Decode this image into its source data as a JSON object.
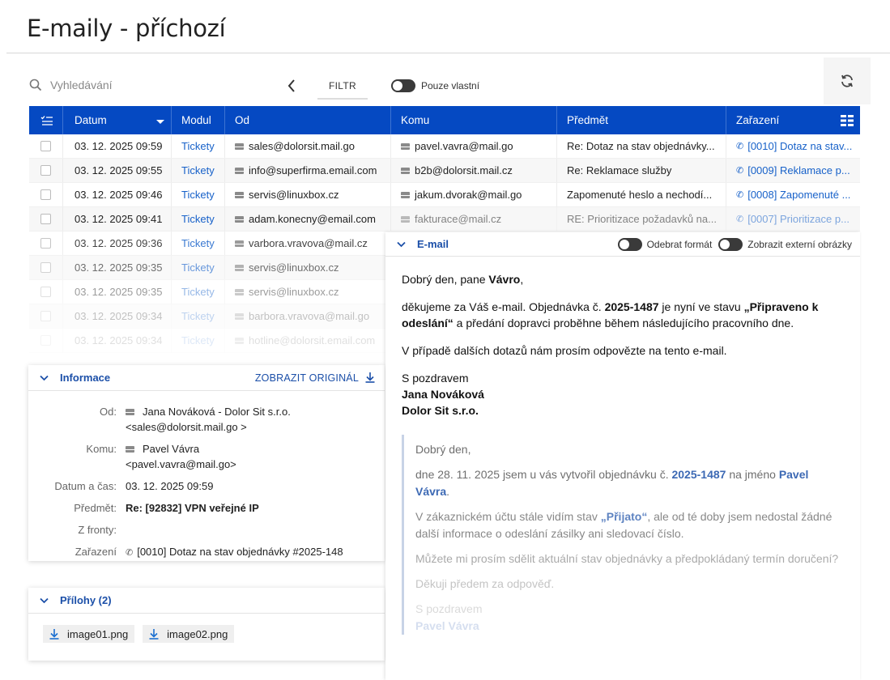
{
  "page": {
    "title": "E-maily - příchozí"
  },
  "toolbar": {
    "search_placeholder": "Vyhledávání",
    "filter_label": "FILTR",
    "own_only_label": "Pouze vlastní"
  },
  "grid": {
    "columns": [
      "Datum",
      "Modul",
      "Od",
      "Komu",
      "Předmět",
      "Zařazení"
    ],
    "rows": [
      {
        "date": "03. 12. 2025 09:59",
        "module": "Tickety",
        "from": "sales@dolorsit.mail.go",
        "to": "pavel.vavra@mail.go",
        "subject": "Re: Dotaz na stav objednávky...",
        "category": "[0010] Dotaz na stav..."
      },
      {
        "date": "03. 12. 2025 09:55",
        "module": "Tickety",
        "from": "info@superfirma.email.com",
        "to": "b2b@dolorsit.mail.cz",
        "subject": "Re: Reklamace služby",
        "category": "[0009] Reklamace p..."
      },
      {
        "date": "03. 12. 2025 09:46",
        "module": "Tickety",
        "from": "servis@linuxbox.cz",
        "to": "jakum.dvorak@mail.go",
        "subject": "Zapomenuté heslo a nechodí...",
        "category": "[0008] Zapomenuté ..."
      },
      {
        "date": "03. 12. 2025 09:41",
        "module": "Tickety",
        "from": "adam.konecny@email.com",
        "to": "fakturace@mail.cz",
        "subject": "RE: Prioritizace požadavků na...",
        "category": "[0007] Prioritizace p..."
      },
      {
        "date": "03. 12. 2025 09:36",
        "module": "Tickety",
        "from": "varbora.vravova@mail.cz"
      },
      {
        "date": "03. 12. 2025 09:35",
        "module": "Tickety",
        "from": "servis@linuxbox.cz"
      },
      {
        "date": "03. 12. 2025 09:35",
        "module": "Tickety",
        "from": "servis@linuxbox.cz"
      },
      {
        "date": "03. 12. 2025 09:34",
        "module": "Tickety",
        "from": "barbora.vravova@mail.go"
      },
      {
        "date": "03. 12. 2025 09:34",
        "module": "Tickety",
        "from": "hotline@dolorsit.email.com"
      }
    ]
  },
  "info": {
    "title": "Informace",
    "show_original": "ZOBRAZIT ORIGINÁL",
    "from_label": "Od:",
    "from_name": "Jana Nováková - Dolor Sit s.r.o.",
    "from_email": "<sales@dolorsit.mail.go >",
    "to_label": "Komu:",
    "to_name": "Pavel Vávra",
    "to_email": "<pavel.vavra@mail.go>",
    "datetime_label": "Datum a čas:",
    "datetime": "03. 12. 2025 09:59",
    "subject_label": "Předmět:",
    "subject": "Re: [92832] VPN veřejné IP",
    "queue_label": "Z fronty:",
    "category_label": "Zařazení",
    "category": "[0010] Dotaz na stav objednávky #2025-148"
  },
  "attachments": {
    "title": "Přílohy (2)",
    "files": [
      "image01.png",
      "image02.png"
    ]
  },
  "email": {
    "title": "E-mail",
    "toggle_remove_format": "Odebrat formát",
    "toggle_external_images": "Zobrazit externí obrázky",
    "greeting_prefix": "Dobrý den, pane ",
    "greeting_name": "Vávro",
    "greeting_suffix": ",",
    "p1_a": "děkujeme za Váš e-mail. Objednávka č. ",
    "p1_order": "2025-1487",
    "p1_b": " je nyní ve stavu ",
    "p1_state": "„Připraveno k odeslání“",
    "p1_c": " a předání dopravci proběhne během následujícího pracovního dne.",
    "p2": "V případě dalších dotazů nám prosím odpovězte na tento e-mail.",
    "sign_1": "S pozdravem",
    "sign_2": "Jana Nováková",
    "sign_3": "Dolor Sit s.r.o.",
    "quote": {
      "greeting": "Dobrý den,",
      "q1_a": "dne 28. 11. 2025 jsem u vás vytvořil objednávku č. ",
      "q1_order": "2025-1487",
      "q1_b": " na jméno ",
      "q1_name": "Pavel Vávra",
      "q1_c": ".",
      "q2_a": "V zákaznickém účtu stále vidím stav ",
      "q2_state": "„Přijato“",
      "q2_b": ", ale od té doby jsem nedostal žádné další informace o odeslání zásilky ani sledovací číslo.",
      "q3": "Můžete mi prosím sdělit aktuální stav objednávky a předpokládaný termín doručení?",
      "q4": "Děkuji předem za odpověď.",
      "q5": "S pozdravem",
      "q6": "Pavel Vávra"
    }
  },
  "colors": {
    "header_blue": "#0549c2",
    "link_blue": "#1761c9"
  }
}
